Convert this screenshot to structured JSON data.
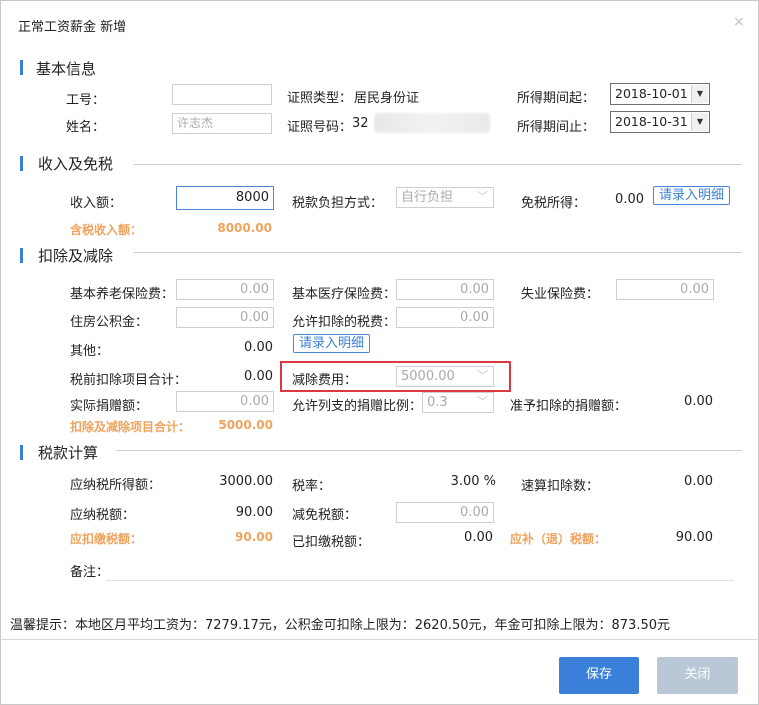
{
  "dialog": {
    "title": "正常工资薪金 新增",
    "close_icon": "×"
  },
  "basic": {
    "section_title": "基本信息",
    "emp_no_label": "工号：",
    "emp_no_value": "",
    "name_label": "姓名：",
    "name_value": "许志杰",
    "id_type_label": "证照类型：",
    "id_type_value": "居民身份证",
    "id_no_label": "证照号码：",
    "id_no_value": "32",
    "period_start_label": "所得期间起：",
    "period_start_value": "2018-10-01",
    "period_end_label": "所得期间止：",
    "period_end_value": "2018-10-31"
  },
  "income": {
    "section_title": "收入及免税",
    "income_label": "收入额：",
    "income_value": "8000",
    "tax_bearing_label": "税款负担方式：",
    "tax_bearing_value": "自行负担",
    "exempt_label": "免税所得：",
    "exempt_value": "0.00",
    "detail_button": "请录入明细",
    "taxable_income_label": "含税收入额：",
    "taxable_income_value": "8000.00"
  },
  "deduction": {
    "section_title": "扣除及减除",
    "pension_label": "基本养老保险费：",
    "pension_value": "0.00",
    "medical_label": "基本医疗保险费：",
    "medical_value": "0.00",
    "unemployment_label": "失业保险费：",
    "unemployment_value": "0.00",
    "housing_label": "住房公积金：",
    "housing_value": "0.00",
    "allowed_tax_label": "允许扣除的税费：",
    "allowed_tax_value": "0.00",
    "other_label": "其他：",
    "other_value": "0.00",
    "detail_button": "请录入明细",
    "pretax_total_label": "税前扣除项目合计：",
    "pretax_total_value": "0.00",
    "reduction_fee_label": "减除费用：",
    "reduction_fee_value": "5000.00",
    "actual_donation_label": "实际捐赠额：",
    "actual_donation_value": "0.00",
    "donation_ratio_label": "允许列支的捐赠比例：",
    "donation_ratio_value": "0.3",
    "deductible_donation_label": "准予扣除的捐赠额：",
    "deductible_donation_value": "0.00",
    "total_label": "扣除及减除项目合计：",
    "total_value": "5000.00"
  },
  "tax": {
    "section_title": "税款计算",
    "taxable_label": "应纳税所得额：",
    "taxable_value": "3000.00",
    "rate_label": "税率：",
    "rate_value": "3.00 %",
    "quick_deduction_label": "速算扣除数：",
    "quick_deduction_value": "0.00",
    "tax_payable_label": "应纳税额：",
    "tax_payable_value": "90.00",
    "relief_label": "减免税额：",
    "relief_value": "0.00",
    "withhold_label": "应扣缴税额：",
    "withhold_value": "90.00",
    "withheld_label": "已扣缴税额：",
    "withheld_value": "0.00",
    "refund_label": "应补（退）税额：",
    "refund_value": "90.00",
    "note_label": "备注："
  },
  "tip": "温馨提示：本地区月平均工资为：7279.17元，公积金可扣除上限为：2620.50元，年金可扣除上限为：873.50元",
  "buttons": {
    "save": "保存",
    "close": "关闭"
  },
  "colors": {
    "accent": "#3a7fd8",
    "orange": "#f0a35e",
    "highlight": "#d9393f"
  }
}
